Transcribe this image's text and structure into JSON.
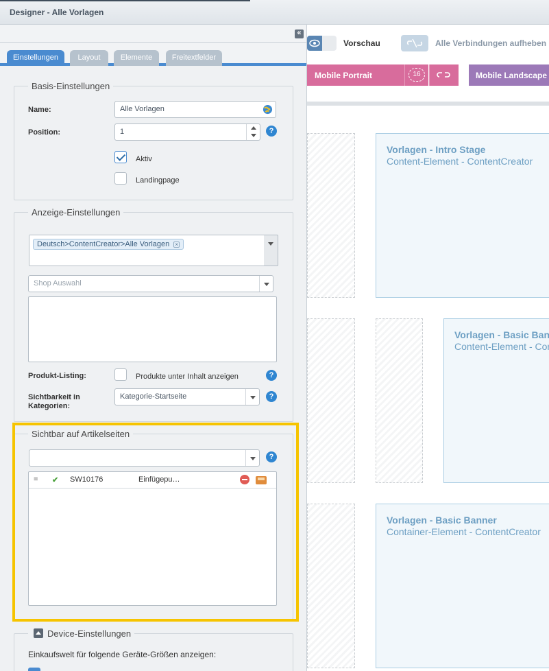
{
  "window": {
    "title": "Designer - Alle Vorlagen"
  },
  "toolbar": {
    "preview_label": "Vorschau",
    "disconnect_label": "Alle Verbindungen aufheben"
  },
  "devices": {
    "portrait": {
      "label": "Mobile Portrait",
      "count": "16",
      "color": "#d86c9c"
    },
    "landscape": {
      "label": "Mobile Landscape",
      "color": "#9c79b8"
    }
  },
  "canvas": {
    "cards": [
      {
        "title": "Vorlagen - Intro Stage",
        "subtitle": "Content-Element - ContentCreator"
      },
      {
        "title": "Vorlagen - Basic Banner",
        "subtitle": "Content-Element - ContentCreator"
      },
      {
        "title": "Vorlagen - Basic Banner",
        "subtitle": "Container-Element - ContentCreator"
      }
    ]
  },
  "tabs": [
    {
      "label": "Einstellungen",
      "active": true
    },
    {
      "label": "Layout",
      "active": false
    },
    {
      "label": "Elemente",
      "active": false
    },
    {
      "label": "Freitextfelder",
      "active": false
    }
  ],
  "basis": {
    "legend": "Basis-Einstellungen",
    "name_label": "Name:",
    "name_value": "Alle Vorlagen",
    "position_label": "Position:",
    "position_value": "1",
    "aktiv_label": "Aktiv",
    "aktiv_checked": true,
    "landingpage_label": "Landingpage",
    "landingpage_checked": false
  },
  "anzeige": {
    "legend": "Anzeige-Einstellungen",
    "category_tag": "Deutsch>ContentCreator>Alle Vorlagen",
    "shop_placeholder": "Shop Auswahl",
    "listing_label": "Produkt-Listing:",
    "listing_checkbox_label": "Produkte unter Inhalt anzeigen",
    "visibility_label": "Sichtbarkeit in Kategorien:",
    "visibility_value": "Kategorie-Startseite"
  },
  "articles": {
    "legend": "Sichtbar auf Artikelseiten",
    "rows": [
      {
        "handle": "=",
        "status": "✔",
        "number": "SW10176",
        "name": "Einfügepu…"
      }
    ]
  },
  "device_settings": {
    "legend": "Device-Einstellungen",
    "description": "Einkaufswelt für folgende Geräte-Größen anzeigen:"
  },
  "colors": {
    "accent": "#4a8bd0",
    "highlight": "#f6c400",
    "card_text": "#6d9fc3"
  }
}
